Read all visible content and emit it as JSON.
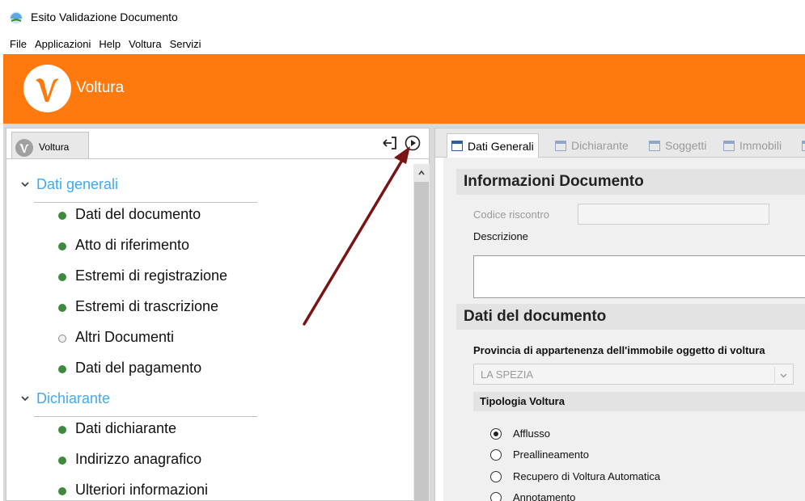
{
  "window": {
    "title": "Esito Validazione Documento"
  },
  "menu": [
    "File",
    "Applicazioni",
    "Help",
    "Voltura",
    "Servizi"
  ],
  "header": {
    "brand": "Voltura",
    "brand_color": "#ff7a0e",
    "logo_letter": "V"
  },
  "left_panel": {
    "tab_label": "Voltura",
    "icons": {
      "collapse": "collapse-panel-icon",
      "play": "play-circle-icon"
    },
    "sections": [
      {
        "label": "Dati generali",
        "items": [
          {
            "label": "Dati del documento",
            "status": "filled"
          },
          {
            "label": "Atto di riferimento",
            "status": "filled"
          },
          {
            "label": "Estremi di registrazione",
            "status": "filled"
          },
          {
            "label": "Estremi di trascrizione",
            "status": "filled"
          },
          {
            "label": "Altri Documenti",
            "status": "empty"
          },
          {
            "label": "Dati del pagamento",
            "status": "filled"
          }
        ]
      },
      {
        "label": "Dichiarante",
        "items": [
          {
            "label": "Dati dichiarante",
            "status": "filled"
          },
          {
            "label": "Indirizzo anagrafico",
            "status": "filled"
          },
          {
            "label": "Ulteriori informazioni",
            "status": "filled"
          }
        ]
      }
    ],
    "accent_color": "#3fa9f5",
    "status_color": "#3d8a3d"
  },
  "right_panel": {
    "tabs": [
      {
        "label": "Dati Generali",
        "active": true
      },
      {
        "label": "Dichiarante",
        "active": false
      },
      {
        "label": "Soggetti",
        "active": false
      },
      {
        "label": "Immobili",
        "active": false
      }
    ],
    "info_section": {
      "title": "Informazioni Documento",
      "codice_label": "Codice riscontro",
      "codice_value": "",
      "descrizione_label": "Descrizione",
      "descrizione_value": ""
    },
    "doc_section": {
      "title": "Dati del documento",
      "provincia_label": "Provincia di appartenenza dell'immobile oggetto di voltura",
      "provincia_value": "LA SPEZIA",
      "tipologia_title": "Tipologia Voltura",
      "options": [
        {
          "label": "Afflusso",
          "selected": true
        },
        {
          "label": "Preallineamento",
          "selected": false
        },
        {
          "label": "Recupero di Voltura Automatica",
          "selected": false
        },
        {
          "label": "Annotamento",
          "selected": false
        }
      ]
    }
  },
  "annotation": {
    "arrow_color": "#7a1414"
  }
}
